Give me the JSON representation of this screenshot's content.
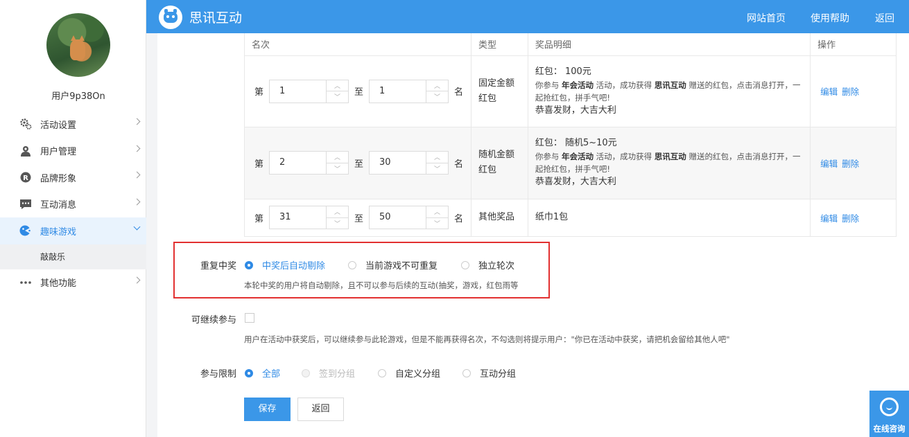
{
  "app": {
    "title": "思讯互动"
  },
  "header": {
    "links": [
      "网站首页",
      "使用帮助",
      "返回"
    ]
  },
  "user": {
    "name": "用户9p38On"
  },
  "sidebar": {
    "items": [
      {
        "label": "活动设置",
        "icon": "gear-icon"
      },
      {
        "label": "用户管理",
        "icon": "user-icon"
      },
      {
        "label": "品牌形象",
        "icon": "registered-icon"
      },
      {
        "label": "互动消息",
        "icon": "message-icon"
      },
      {
        "label": "趣味游戏",
        "icon": "game-icon",
        "active": true
      },
      {
        "label": "其他功能",
        "icon": "more-icon"
      }
    ],
    "sub_item": "敲敲乐"
  },
  "table": {
    "headers": [
      "名次",
      "类型",
      "奖品明细",
      "操作"
    ],
    "rank_prefix": "第",
    "rank_mid": "至",
    "rank_suffix": "名",
    "rows": [
      {
        "from": "1",
        "to": "1",
        "type_line1": "固定金额",
        "type_line2": "红包",
        "detail_main": "红包： 100元",
        "desc_a": "你参与 ",
        "desc_b": "年会活动",
        "desc_c": " 活动，成功获得 ",
        "desc_d": "思讯互动",
        "desc_e": " 赠送的红包，点击消息打开，一",
        "desc_line2": "起抢红包，拼手气吧!",
        "wish": "恭喜发财，大吉大利",
        "op_edit": "编辑",
        "op_delete": "删除"
      },
      {
        "from": "2",
        "to": "30",
        "type_line1": "随机金额",
        "type_line2": "红包",
        "detail_main": "红包： 随机5~10元",
        "desc_a": "你参与 ",
        "desc_b": "年会活动",
        "desc_c": " 活动，成功获得 ",
        "desc_d": "思讯互动",
        "desc_e": " 赠送的红包，点击消息打开，一",
        "desc_line2": "起抢红包，拼手气吧!",
        "wish": "恭喜发财，大吉大利",
        "op_edit": "编辑",
        "op_delete": "删除"
      },
      {
        "from": "31",
        "to": "50",
        "type_line1": "其他奖品",
        "detail_main": "纸巾1包",
        "op_edit": "编辑",
        "op_delete": "删除"
      }
    ]
  },
  "repeat_win": {
    "label": "重复中奖",
    "options": [
      "中奖后自动剔除",
      "当前游戏不可重复",
      "独立轮次"
    ],
    "selected": "中奖后自动剔除",
    "hint": "本轮中奖的用户将自动剔除，且不可以参与后续的互动(抽奖，游戏，红包雨等"
  },
  "continue_join": {
    "label": "可继续参与",
    "checked": false,
    "hint": "用户在活动中获奖后，可以继续参与此轮游戏，但是不能再获得名次，不勾选则将提示用户：\"你已在活动中获奖，请把机会留给其他人吧\""
  },
  "join_limit": {
    "label": "参与限制",
    "options": [
      "全部",
      "签到分组",
      "自定义分组",
      "互动分组"
    ],
    "selected": "全部",
    "disabled": "签到分组"
  },
  "buttons": {
    "save": "保存",
    "back": "返回"
  },
  "consult": {
    "label": "在线咨询"
  },
  "colors": {
    "primary": "#3b97e8",
    "highlight_box": "#e23030",
    "link": "#2f8ae5"
  }
}
